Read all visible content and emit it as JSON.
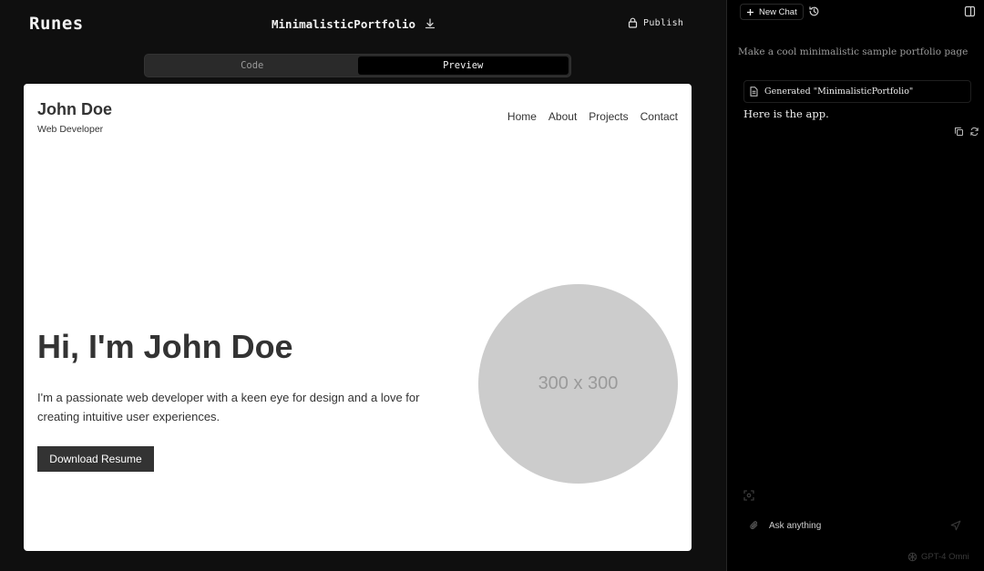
{
  "header": {
    "brand": "Runes",
    "project_title": "MinimalisticPortfolio",
    "download_icon": "download-icon",
    "publish_label": "Publish",
    "publish_icon": "lock-icon"
  },
  "view_toggle": {
    "code_label": "Code",
    "preview_label": "Preview",
    "active": "Preview"
  },
  "preview": {
    "name": "John Doe",
    "role": "Web Developer",
    "nav": [
      "Home",
      "About",
      "Projects",
      "Contact"
    ],
    "hero_title": "Hi, I'm John Doe",
    "hero_text": "I'm a passionate web developer with a keen eye for design and a love for creating intuitive user experiences.",
    "button_label": "Download Resume",
    "image_placeholder": "300 x 300"
  },
  "chat": {
    "new_chat_label": "New Chat",
    "user_message": "Make a cool minimalistic sample portfolio page",
    "artifact_label": "Generated \"MinimalisticPortfolio\"",
    "assistant_reply": "Here is the app.",
    "input_placeholder": "Ask anything",
    "model_label": "GPT-4 Omni"
  },
  "colors": {
    "app_bg": "#0f0f0f",
    "chat_bg": "#000000",
    "preview_bg": "#ffffff",
    "text_dark": "#333333",
    "avatar_gray": "#cccccc"
  }
}
